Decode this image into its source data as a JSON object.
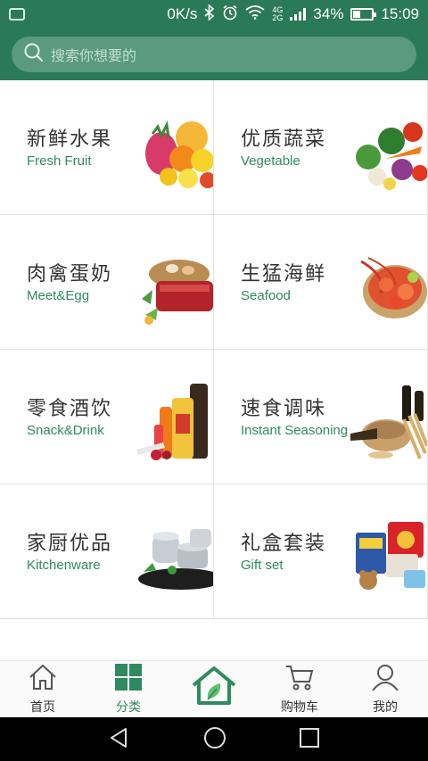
{
  "status_bar": {
    "speed": "0K/s",
    "net_top": "4G",
    "net_bottom": "2G",
    "battery": "34%",
    "time": "15:09"
  },
  "search": {
    "placeholder": "搜索你想要的"
  },
  "categories": [
    {
      "title": "新鲜水果",
      "subtitle": "Fresh Fruit"
    },
    {
      "title": "优质蔬菜",
      "subtitle": "Vegetable"
    },
    {
      "title": "肉禽蛋奶",
      "subtitle": "Meet&Egg"
    },
    {
      "title": "生猛海鲜",
      "subtitle": "Seafood"
    },
    {
      "title": "零食酒饮",
      "subtitle": "Snack&Drink"
    },
    {
      "title": "速食调味",
      "subtitle": "Instant Seasoning"
    },
    {
      "title": "家厨优品",
      "subtitle": "Kitchenware"
    },
    {
      "title": "礼盒套装",
      "subtitle": "Gift set"
    }
  ],
  "bottom_nav": {
    "items": [
      {
        "label": "首页",
        "icon": "home-icon",
        "active": false
      },
      {
        "label": "分类",
        "icon": "grid-icon",
        "active": true
      },
      {
        "label": "",
        "icon": "leaf-house-icon",
        "active": false
      },
      {
        "label": "购物车",
        "icon": "cart-icon",
        "active": false
      },
      {
        "label": "我的",
        "icon": "person-icon",
        "active": false
      }
    ]
  },
  "colors": {
    "brand_green": "#2b7a57",
    "accent_green": "#2f8a5e"
  }
}
